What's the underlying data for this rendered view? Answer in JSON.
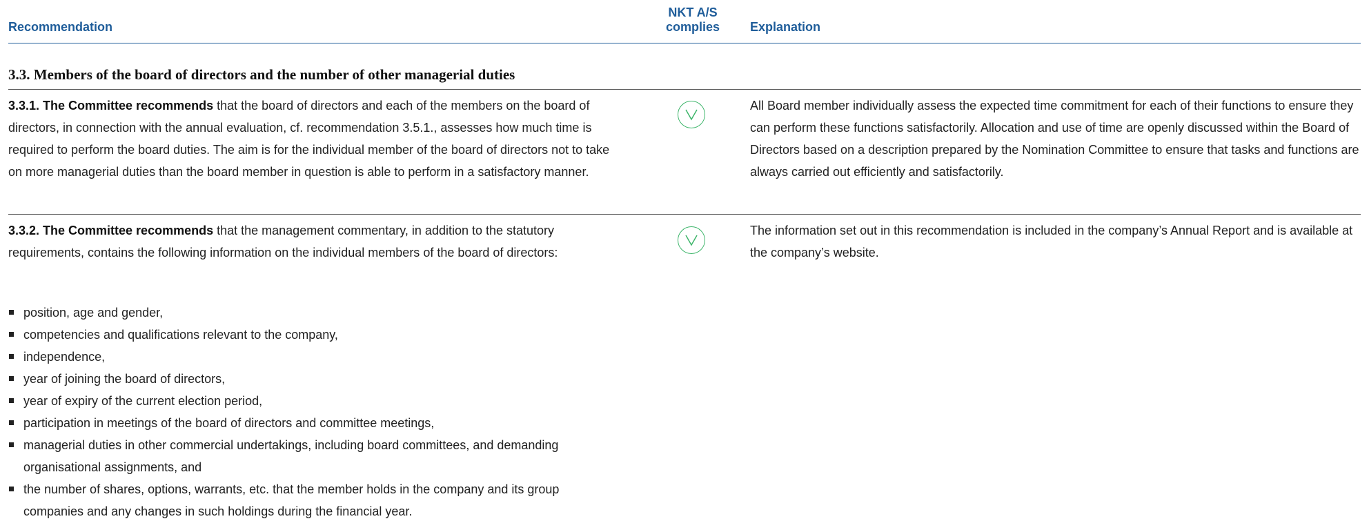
{
  "header": {
    "recommendation": "Recommendation",
    "complies_line1": "NKT A/S",
    "complies_line2": "complies",
    "explanation": "Explanation"
  },
  "section": {
    "title": "3.3. Members of the board of directors and the number of other managerial duties"
  },
  "rows": [
    {
      "lead": "3.3.1. The Committee recommends",
      "text": " that the board of directors and each of the members on the board of directors, in connection with the annual evaluation, cf. recommendation 3.5.1., assesses how much time is required to perform the board duties. The aim is for the individual member of the board of directors not to take on more managerial duties than the board member in question is able to perform in a satisfactory manner.",
      "complies_icon": "check-circle-icon",
      "explanation": "All Board member individually assess the expected time commitment for each of their functions to ensure they can perform these functions satisfactorily. Allocation and use of time are openly discussed within the Board of Directors based on a description prepared by the Nomination Committee to ensure that tasks and functions are always carried out efficiently and satisfactorily."
    },
    {
      "lead": "3.3.2. The Committee recommends",
      "text": " that the management commentary, in addition to the statutory requirements, contains the following information on the individual members of the board of directors:",
      "complies_icon": "check-circle-icon",
      "explanation": "The information set out in this recommendation is included in the company’s Annual Report and is available at the company’s website.",
      "bullets": [
        "position, age and gender,",
        "competencies and qualifications relevant to the company,",
        "independence,",
        "year of joining the board of directors,",
        "year of expiry of the current election period,",
        "participation in meetings of the board of directors and committee meetings,",
        "managerial duties in other commercial undertakings, including board committees, and demanding organisational assignments, and",
        "the number of shares, options, warrants, etc. that the member holds in the company and its group companies and any changes in such holdings during the financial year."
      ]
    }
  ],
  "colors": {
    "header_blue": "#1f5d9a",
    "check_green": "#3db56a"
  }
}
